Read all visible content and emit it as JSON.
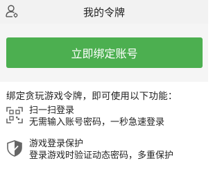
{
  "header": {
    "title": "我的令牌",
    "left_icon": "user-settings-icon"
  },
  "main": {
    "bind_button_label": "立即绑定账号",
    "intro_text": "绑定贪玩游戏令牌，即可使用以下功能："
  },
  "features": [
    {
      "icon": "qr-scan-icon",
      "title": "扫一扫登录",
      "description": "无需输入账号密码，一秒急速登录"
    },
    {
      "icon": "shield-icon",
      "title": "游戏登录保护",
      "description": "登录游戏时验证动态密码，多重保护"
    }
  ],
  "colors": {
    "accent": "#4caf50",
    "header_bg": "#f2f2f2"
  }
}
